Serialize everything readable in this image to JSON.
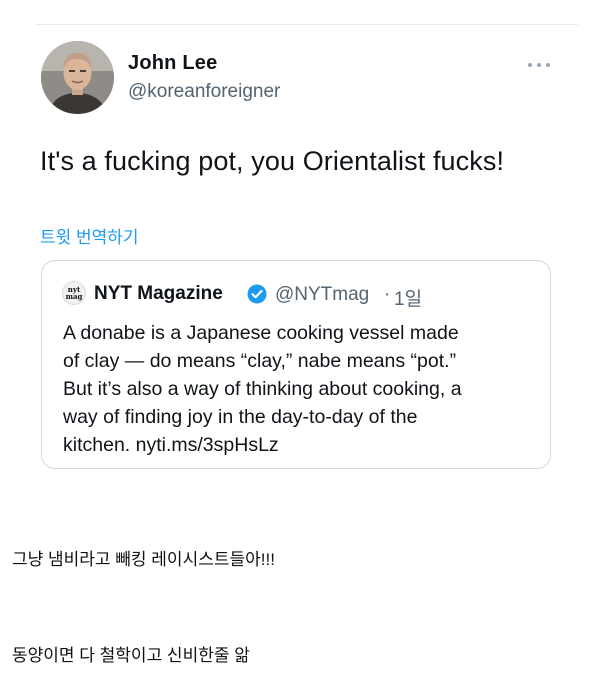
{
  "tweet": {
    "author_name": "John Lee",
    "author_handle": "@koreanforeigner",
    "text": "It's a fucking pot, you Orientalist fucks!",
    "translate_label": "트윗 번역하기",
    "more_icon": "more-horizontal-icon",
    "quoted": {
      "logo_text": "nyt mag",
      "author_name": "NYT Magazine",
      "verified_icon": "verified-badge-icon",
      "author_handle": "@NYTmag",
      "separator": "·",
      "time": "1일",
      "lines": [
        "A donabe is a Japanese cooking vessel made",
        "of clay — do means “clay,” nabe means “pot.”",
        "But  it’s also a way of thinking about cooking, a",
        "way of finding joy in the day-to-day of the",
        "kitchen.  nyti.ms/3spHsLz"
      ]
    }
  },
  "comments": {
    "first": "그냥 냄비라고 빼킹 레이시스트들아!!!",
    "second": "동양이면 다 철학이고 신비한줄 앎"
  },
  "colors": {
    "link": "#1d9bf0",
    "secondary_text": "#536471",
    "border": "#cfd9de",
    "verified": "#1d9bf0"
  }
}
